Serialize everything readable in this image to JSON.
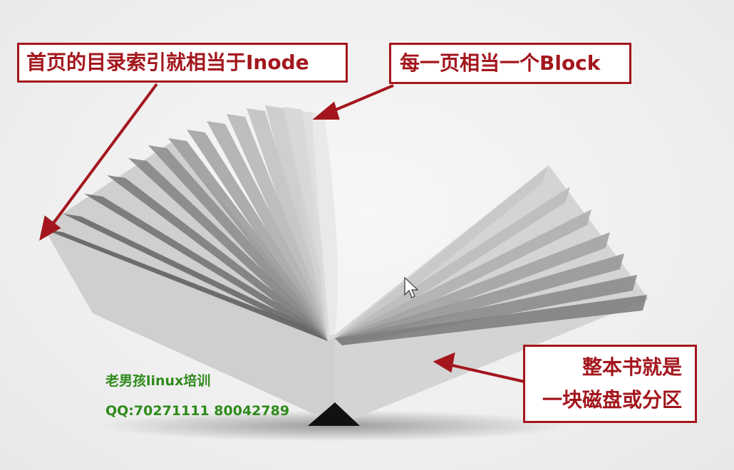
{
  "callouts": {
    "inode": "首页的目录索引就相当于Inode",
    "block": "每一页相当一个Block",
    "disk_line1": "整本书就是",
    "disk_line2": "一块磁盘或分区"
  },
  "watermark": {
    "name": "老男孩linux培训",
    "qq": "QQ:70271111 80042789"
  },
  "colors": {
    "callout_red": "#a3161d",
    "watermark_green": "#2e8a1a"
  },
  "icons": {
    "cursor": "mouse-pointer-icon"
  }
}
